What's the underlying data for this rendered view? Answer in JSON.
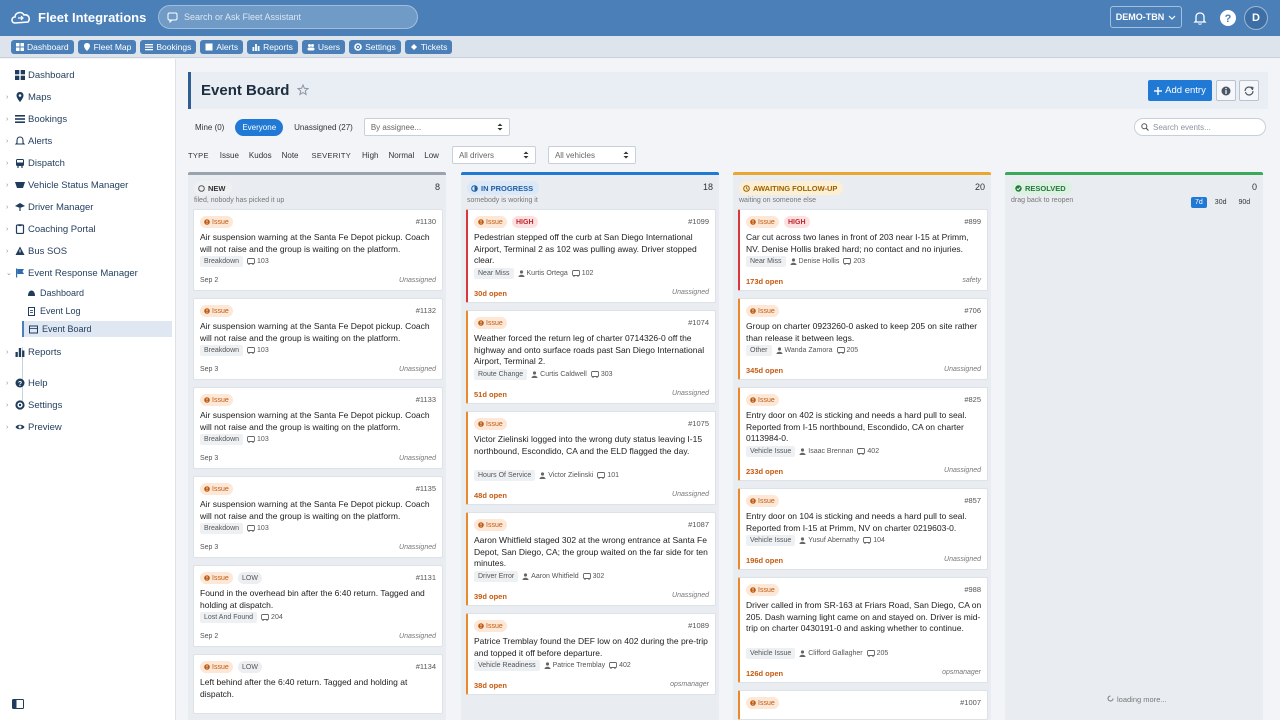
{
  "app": {
    "title": "Fleet Integrations",
    "assistant_placeholder": "Search or Ask Fleet Assistant",
    "tenant": "DEMO-TBN",
    "avatar_initial": "D"
  },
  "nav": [
    "Dashboard",
    "Fleet Map",
    "Bookings",
    "Alerts",
    "Reports",
    "Users",
    "Settings",
    "Tickets"
  ],
  "sidebar": {
    "items": [
      "Dashboard",
      "Maps",
      "Bookings",
      "Alerts",
      "Dispatch",
      "Vehicle Status Manager",
      "Driver Manager",
      "Coaching Portal",
      "Bus SOS",
      "Event Response Manager"
    ],
    "sub_items": [
      "Dashboard",
      "Event Log",
      "Event Board"
    ],
    "bottom": [
      "Reports",
      "Help",
      "Settings",
      "Preview"
    ]
  },
  "page": {
    "title": "Event Board",
    "add_label": "Add entry"
  },
  "filters": {
    "scope": [
      "Mine (0)",
      "Everyone",
      "Unassigned (27)"
    ],
    "assignee": "By assignee...",
    "search_placeholder": "Search events...",
    "type_label": "TYPE",
    "types": [
      "Issue",
      "Kudos",
      "Note"
    ],
    "severity_label": "SEVERITY",
    "severities": [
      "High",
      "Normal",
      "Low"
    ],
    "drivers": "All drivers",
    "vehicles": "All vehicles"
  },
  "columns": [
    {
      "name": "NEW",
      "count": "8",
      "subtitle": "filed, nobody has picked it up",
      "color": "#9aa3ad",
      "cards": [
        {
          "type": "Issue",
          "id": "#1130",
          "text": "Air suspension warning at the Santa Fe Depot pickup. Coach will not raise and the group is waiting on the platform.",
          "tag": "Breakdown",
          "vehicle": "103",
          "footer": "Sep 2",
          "assignee": "Unassigned"
        },
        {
          "type": "Issue",
          "id": "#1132",
          "text": "Air suspension warning at the Santa Fe Depot pickup. Coach will not raise and the group is waiting on the platform.",
          "tag": "Breakdown",
          "vehicle": "103",
          "footer": "Sep 3",
          "assignee": "Unassigned"
        },
        {
          "type": "Issue",
          "id": "#1133",
          "text": "Air suspension warning at the Santa Fe Depot pickup. Coach will not raise and the group is waiting on the platform.",
          "tag": "Breakdown",
          "vehicle": "103",
          "footer": "Sep 3",
          "assignee": "Unassigned"
        },
        {
          "type": "Issue",
          "id": "#1135",
          "text": "Air suspension warning at the Santa Fe Depot pickup. Coach will not raise and the group is waiting on the platform.",
          "tag": "Breakdown",
          "vehicle": "103",
          "footer": "Sep 3",
          "assignee": "Unassigned"
        },
        {
          "type": "Issue",
          "severity": "LOW",
          "id": "#1131",
          "text": "Found in the overhead bin after the 6:40 return. Tagged and holding at dispatch.",
          "tag": "Lost And Found",
          "vehicle": "204",
          "footer": "Sep 2",
          "assignee": "Unassigned"
        },
        {
          "type": "Issue",
          "severity": "LOW",
          "id": "#1134",
          "text": "Left behind after the 6:40 return. Tagged and holding at dispatch."
        }
      ]
    },
    {
      "name": "IN PROGRESS",
      "count": "18",
      "subtitle": "somebody is working it",
      "color": "#2079d4",
      "cards": [
        {
          "type": "Issue",
          "severity": "HIGH",
          "id": "#1099",
          "text": "Pedestrian stepped off the curb at San Diego International Airport, Terminal 2 as 102 was pulling away. Driver stopped clear.",
          "tag": "Near Miss",
          "driver": "Kurtis Ortega",
          "vehicle": "102",
          "footer": "30d open",
          "assignee": "Unassigned"
        },
        {
          "type": "Issue",
          "id": "#1074",
          "text": "Weather forced the return leg of charter 0714326-0 off the highway and onto surface roads past San Diego International Airport, Terminal 2.",
          "tag": "Route Change",
          "driver": "Curtis Caldwell",
          "vehicle": "303",
          "footer": "51d open",
          "assignee": "Unassigned"
        },
        {
          "type": "Issue",
          "id": "#1075",
          "text": "Victor Zielinski logged into the wrong duty status leaving I-15 northbound, Escondido, CA and the ELD flagged the day.",
          "tag": "Hours Of Service",
          "driver": "Victor Zielinski",
          "vehicle": "101",
          "footer": "48d open",
          "assignee": "Unassigned"
        },
        {
          "type": "Issue",
          "id": "#1087",
          "text": "Aaron Whitfield staged 302 at the wrong entrance at Santa Fe Depot, San Diego, CA; the group waited on the far side for ten minutes.",
          "tag": "Driver Error",
          "driver": "Aaron Whitfield",
          "vehicle": "302",
          "footer": "39d open",
          "assignee": "Unassigned"
        },
        {
          "type": "Issue",
          "id": "#1089",
          "text": "Patrice Tremblay found the DEF low on 402 during the pre-trip and topped it off before departure.",
          "tag": "Vehicle Readiness",
          "driver": "Patrice Tremblay",
          "vehicle": "402",
          "footer": "38d open",
          "assignee": "opsmanager"
        }
      ]
    },
    {
      "name": "AWAITING FOLLOW-UP",
      "count": "20",
      "subtitle": "waiting on someone else",
      "color": "#e8a830",
      "cards": [
        {
          "type": "Issue",
          "severity": "HIGH",
          "id": "#899",
          "text": "Car cut across two lanes in front of 203 near I-15 at Primm, NV. Denise Hollis braked hard; no contact and no injuries.",
          "tag": "Near Miss",
          "driver": "Denise Hollis",
          "vehicle": "203",
          "footer": "173d open",
          "assignee": "safety"
        },
        {
          "type": "Issue",
          "id": "#706",
          "text": "Group on charter 0923260-0 asked to keep 205 on site rather than release it between legs.",
          "tag": "Other",
          "driver": "Wanda Zamora",
          "vehicle": "205",
          "footer": "345d open",
          "assignee": "Unassigned"
        },
        {
          "type": "Issue",
          "id": "#825",
          "text": "Entry door on 402 is sticking and needs a hard pull to seal. Reported from I-15 northbound, Escondido, CA on charter 0113984-0.",
          "tag": "Vehicle Issue",
          "driver": "Isaac Brennan",
          "vehicle": "402",
          "footer": "233d open",
          "assignee": "Unassigned"
        },
        {
          "type": "Issue",
          "id": "#857",
          "text": "Entry door on 104 is sticking and needs a hard pull to seal. Reported from I-15 at Primm, NV on charter 0219603-0.",
          "tag": "Vehicle Issue",
          "driver": "Yusuf Abernathy",
          "vehicle": "104",
          "footer": "196d open",
          "assignee": "Unassigned"
        },
        {
          "type": "Issue",
          "id": "#988",
          "text": "Driver called in from SR-163 at Friars Road, San Diego, CA on 205. Dash warning light came on and stayed on. Driver is mid-trip on charter 0430191-0 and asking whether to continue.",
          "tag": "Vehicle Issue",
          "driver": "Clifford Gallagher",
          "vehicle": "205",
          "footer": "126d open",
          "assignee": "opsmanager"
        },
        {
          "type": "Issue",
          "id": "#1007"
        }
      ]
    },
    {
      "name": "RESOLVED",
      "count": "0",
      "subtitle": "drag back to reopen",
      "color": "#3aa95a",
      "ranges": [
        "7d",
        "30d",
        "90d"
      ],
      "loading": "loading more..."
    }
  ]
}
